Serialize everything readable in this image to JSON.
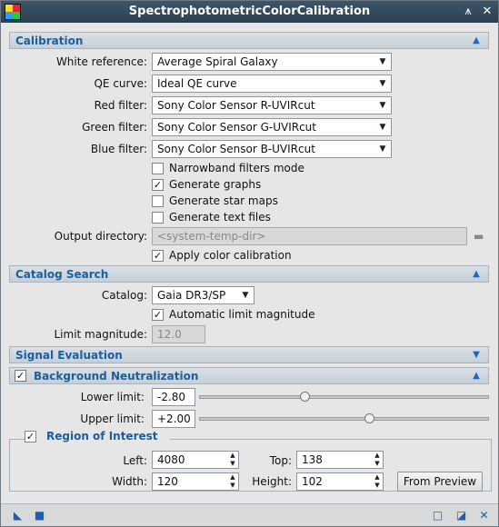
{
  "window": {
    "title": "SpectrophotometricColorCalibration"
  },
  "sections": {
    "calibration": "Calibration",
    "catalog_search": "Catalog Search",
    "signal_evaluation": "Signal Evaluation",
    "background_neutralization": "Background Neutralization"
  },
  "calibration": {
    "white_reference_label": "White reference:",
    "white_reference_value": "Average Spiral Galaxy",
    "qe_curve_label": "QE curve:",
    "qe_curve_value": "Ideal QE curve",
    "red_filter_label": "Red filter:",
    "red_filter_value": "Sony Color Sensor R-UVIRcut",
    "green_filter_label": "Green filter:",
    "green_filter_value": "Sony Color Sensor G-UVIRcut",
    "blue_filter_label": "Blue filter:",
    "blue_filter_value": "Sony Color Sensor B-UVIRcut",
    "narrowband_label": "Narrowband filters mode",
    "narrowband_checked": false,
    "generate_graphs_label": "Generate graphs",
    "generate_graphs_checked": true,
    "generate_star_maps_label": "Generate star maps",
    "generate_star_maps_checked": false,
    "generate_text_files_label": "Generate text files",
    "generate_text_files_checked": false,
    "output_directory_label": "Output directory:",
    "output_directory_placeholder": "<system-temp-dir>",
    "apply_label": "Apply color calibration",
    "apply_checked": true
  },
  "catalog_search": {
    "catalog_label": "Catalog:",
    "catalog_value": "Gaia DR3/SP",
    "auto_limit_label": "Automatic limit magnitude",
    "auto_limit_checked": true,
    "limit_magnitude_label": "Limit magnitude:",
    "limit_magnitude_value": "12.0"
  },
  "background": {
    "enabled": true,
    "lower_limit_label": "Lower limit:",
    "lower_limit_value": "-2.80",
    "lower_limit_fraction": 0.36,
    "upper_limit_label": "Upper limit:",
    "upper_limit_value": "+2.00",
    "upper_limit_fraction": 0.59,
    "roi_label": "Region of Interest",
    "roi_enabled": true,
    "left_label": "Left:",
    "left_value": "4080",
    "top_label": "Top:",
    "top_value": "138",
    "width_label": "Width:",
    "width_value": "120",
    "height_label": "Height:",
    "height_value": "102",
    "from_preview_label": "From Preview"
  },
  "glyphs": {
    "check": "✓",
    "collapse_up": "▲",
    "expand_down": "▼",
    "dropdown": "▼",
    "spin_up": "▲",
    "spin_down": "▼"
  }
}
